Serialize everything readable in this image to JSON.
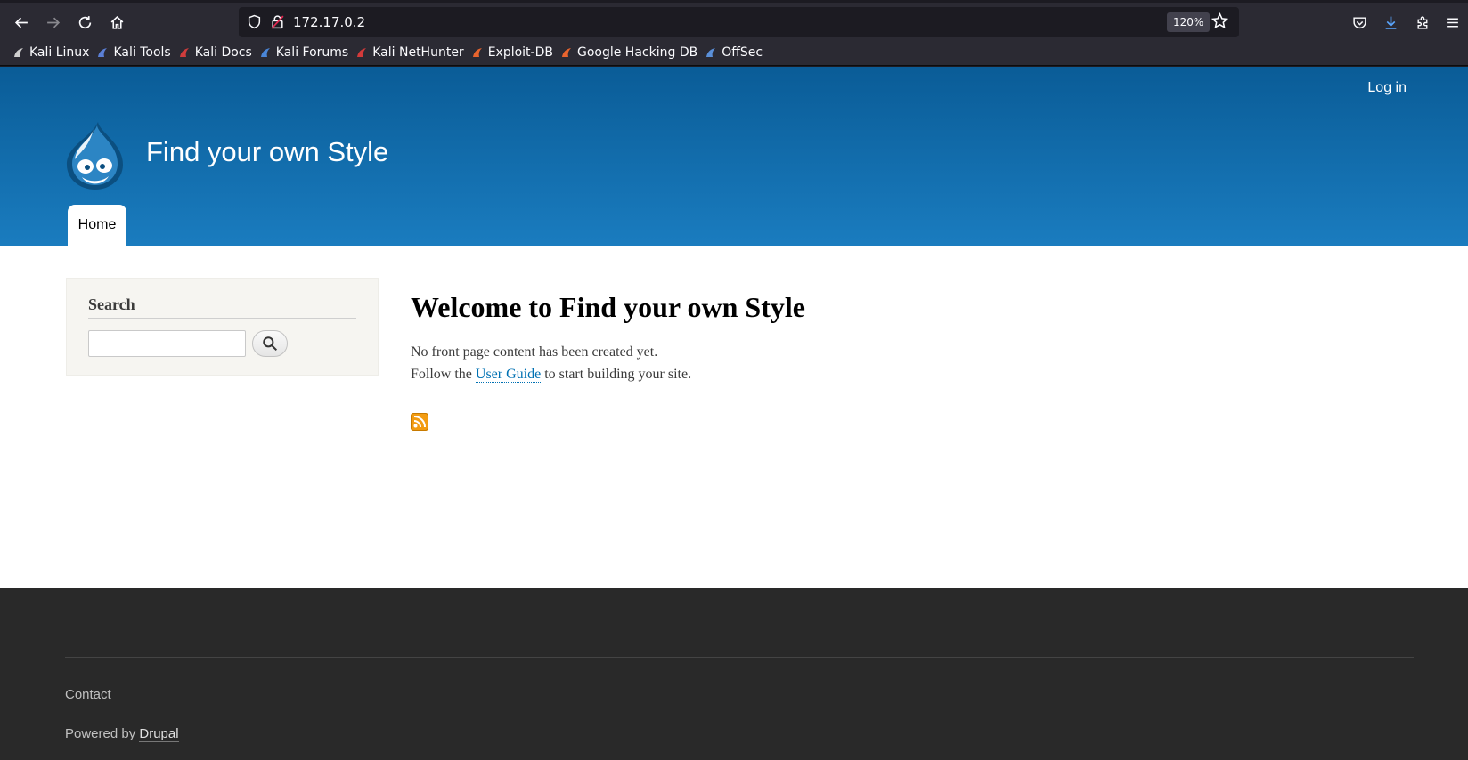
{
  "browser": {
    "url": "172.17.0.2",
    "zoom": "120%",
    "bookmarks": [
      {
        "label": "Kali Linux",
        "icon": "kali-dragon-icon",
        "color": "#cfcfcf"
      },
      {
        "label": "Kali Tools",
        "icon": "kali-tools-icon",
        "color": "#5b7fd6"
      },
      {
        "label": "Kali Docs",
        "icon": "kali-docs-icon",
        "color": "#d03c3c"
      },
      {
        "label": "Kali Forums",
        "icon": "kali-forums-icon",
        "color": "#4a86d8"
      },
      {
        "label": "Kali NetHunter",
        "icon": "nethunter-icon",
        "color": "#d33a3a"
      },
      {
        "label": "Exploit-DB",
        "icon": "exploit-db-icon",
        "color": "#e8642e"
      },
      {
        "label": "Google Hacking DB",
        "icon": "ghdb-icon",
        "color": "#e8642e"
      },
      {
        "label": "OffSec",
        "icon": "offsec-icon",
        "color": "#5a8fd8"
      }
    ]
  },
  "site": {
    "login_label": "Log in",
    "name": "Find your own Style",
    "nav": {
      "home_label": "Home"
    },
    "search": {
      "heading": "Search",
      "input_value": ""
    },
    "main": {
      "title": "Welcome to Find your own Style",
      "line1": "No front page content has been created yet.",
      "line2_prefix": "Follow the ",
      "line2_link": "User Guide",
      "line2_suffix": " to start building your site."
    },
    "footer": {
      "contact": "Contact",
      "powered_prefix": "Powered by ",
      "powered_link": "Drupal"
    },
    "colors": {
      "header_top": "#0a5c97",
      "header_bottom": "#1a7cbf",
      "link": "#0071b3",
      "footer_bg": "#292929",
      "rss": "#f39c12"
    }
  }
}
